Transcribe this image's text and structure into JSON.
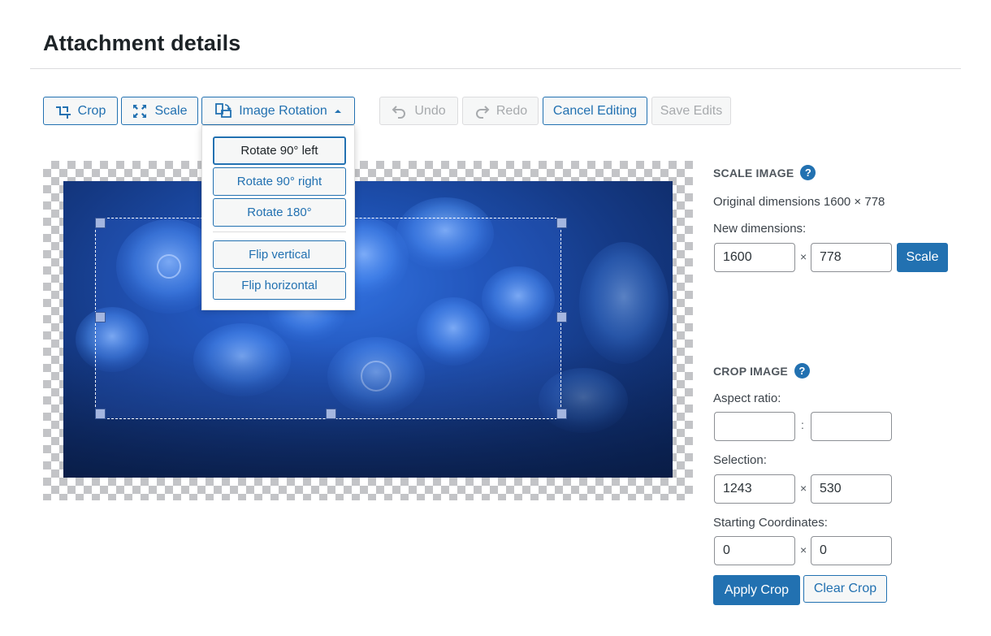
{
  "page": {
    "title": "Attachment details"
  },
  "toolbar": {
    "crop_label": "Crop",
    "scale_label": "Scale",
    "rotation_label": "Image Rotation",
    "undo_label": "Undo",
    "redo_label": "Redo",
    "cancel_label": "Cancel Editing",
    "save_label": "Save Edits"
  },
  "rotation_menu": {
    "items": [
      {
        "label": "Rotate 90° left"
      },
      {
        "label": "Rotate 90° right"
      },
      {
        "label": "Rotate 180°"
      },
      {
        "label": "Flip vertical"
      },
      {
        "label": "Flip horizontal"
      }
    ]
  },
  "scale_panel": {
    "heading": "SCALE IMAGE",
    "original": "Original dimensions 1600 × 778",
    "new_label": "New dimensions:",
    "width": "1600",
    "height": "778",
    "times": "×",
    "button": "Scale"
  },
  "crop_panel": {
    "heading": "CROP IMAGE",
    "aspect_label": "Aspect ratio:",
    "aspect_w": "",
    "aspect_h": "",
    "colon": ":",
    "selection_label": "Selection:",
    "sel_w": "1243",
    "sel_h": "530",
    "coords_label": "Starting Coordinates:",
    "x": "0",
    "y": "0",
    "times": "×",
    "apply": "Apply Crop",
    "clear": "Clear Crop"
  },
  "icons": {
    "help": "?",
    "crop": "crop-icon",
    "scale": "scale-icon",
    "rotation": "rotation-icon",
    "undo": "undo-icon",
    "redo": "redo-icon",
    "caret": "caret-up-icon"
  },
  "colors": {
    "accent": "#2271b1",
    "disabled": "#a7aaad"
  }
}
